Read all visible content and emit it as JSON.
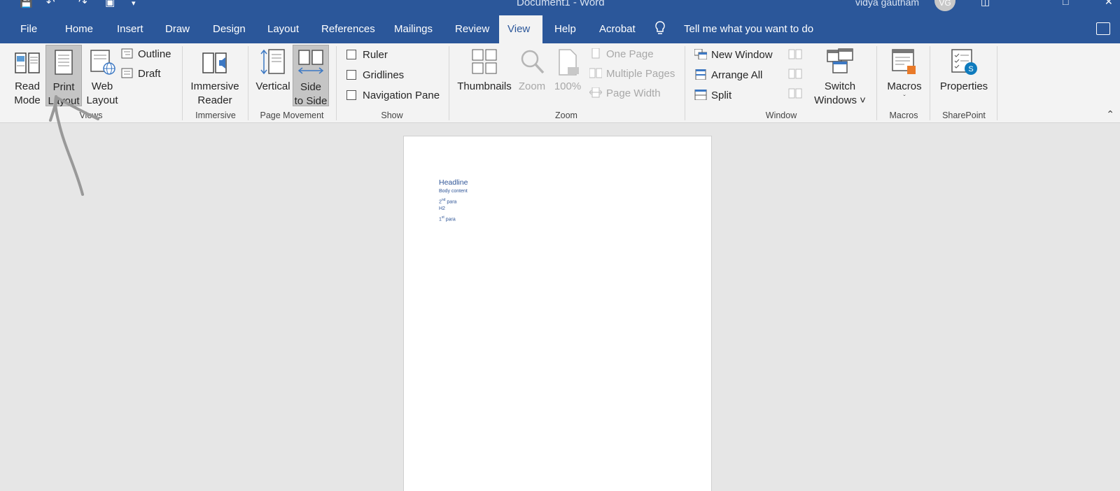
{
  "titlebar": {
    "document_title": "Document1  -  Word",
    "user_name": "vidya gautham",
    "user_initials": "VG"
  },
  "tabs": [
    "File",
    "Home",
    "Insert",
    "Draw",
    "Design",
    "Layout",
    "References",
    "Mailings",
    "Review",
    "View",
    "Help",
    "Acrobat"
  ],
  "active_tab": "View",
  "tell_me": "Tell me what you want to do",
  "ribbon": {
    "views": {
      "label": "Views",
      "read_mode": [
        "Read",
        "Mode"
      ],
      "print_layout": [
        "Print",
        "Layout"
      ],
      "web_layout": [
        "Web",
        "Layout"
      ],
      "outline": "Outline",
      "draft": "Draft"
    },
    "immersive": {
      "label": "Immersive",
      "reader": [
        "Immersive",
        "Reader"
      ]
    },
    "page_movement": {
      "label": "Page Movement",
      "vertical": "Vertical",
      "side_to_side": [
        "Side",
        "to Side"
      ]
    },
    "show": {
      "label": "Show",
      "ruler": "Ruler",
      "gridlines": "Gridlines",
      "navigation_pane": "Navigation Pane"
    },
    "zoom": {
      "label": "Zoom",
      "thumbnails": "Thumbnails",
      "zoom": "Zoom",
      "hundred": "100%",
      "one_page": "One Page",
      "multiple_pages": "Multiple Pages",
      "page_width": "Page Width"
    },
    "window": {
      "label": "Window",
      "new_window": "New Window",
      "arrange_all": "Arrange All",
      "split": "Split",
      "switch_windows": [
        "Switch",
        "Windows ˅"
      ]
    },
    "macros": {
      "label": "Macros",
      "macros": "Macros"
    },
    "sharepoint": {
      "label": "SharePoint",
      "properties": "Properties"
    }
  },
  "document": {
    "headline": "Headline",
    "body_content": "Body content",
    "para2_num": "2",
    "para2_sup": "nd",
    "para2_text": " para",
    "h2": "H2",
    "para1_num": "1",
    "para1_sup": "st",
    "para1_text": " para"
  }
}
